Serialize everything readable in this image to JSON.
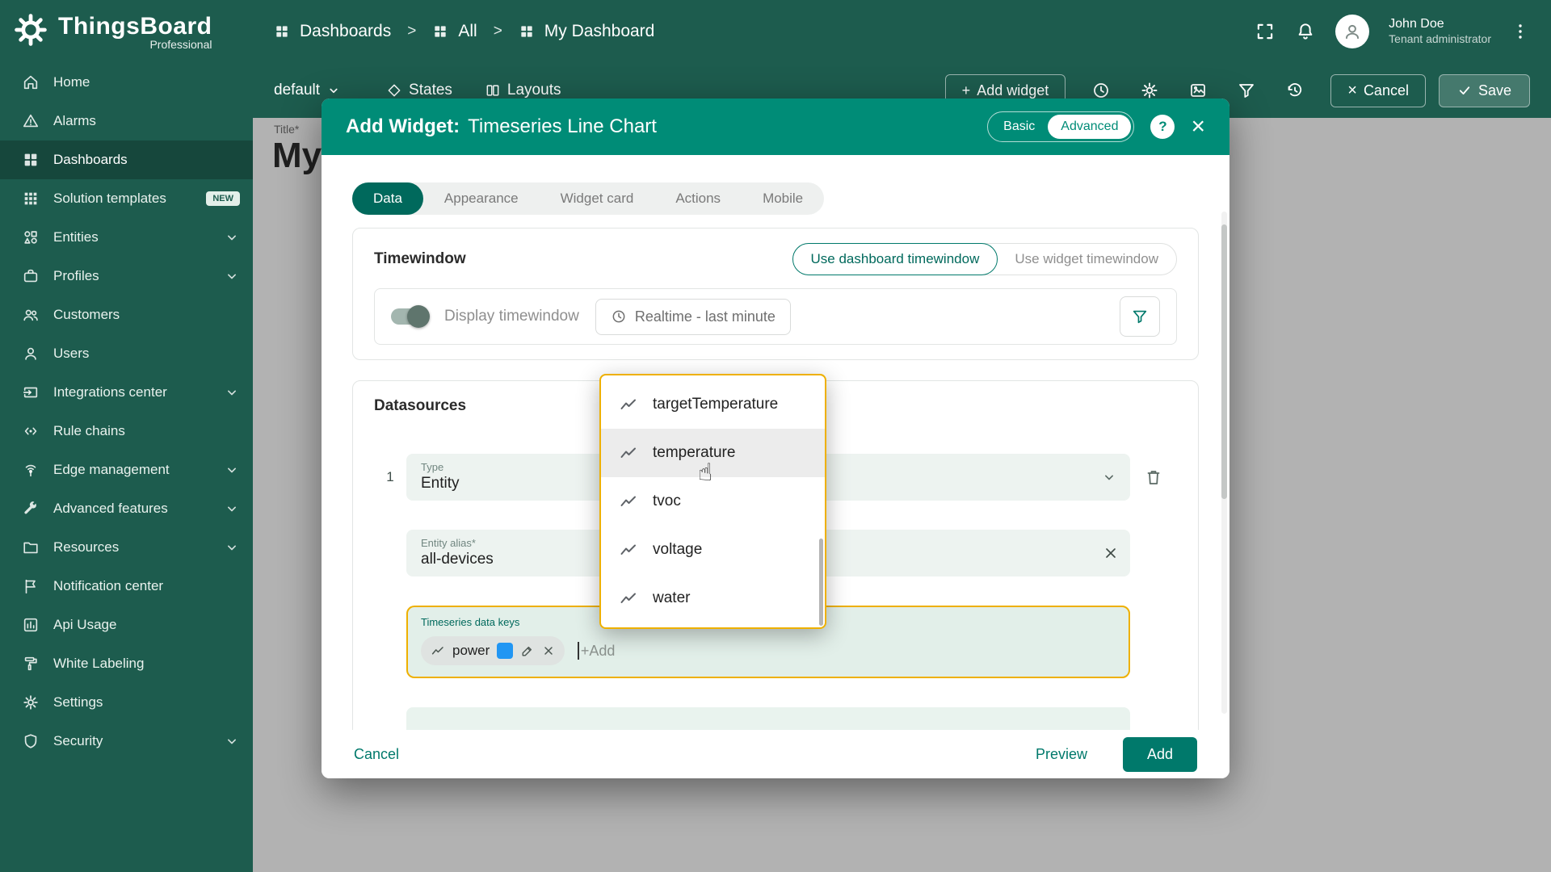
{
  "colors": {
    "sidebar": "#1d5c4e",
    "topbar": "#1d5c4e",
    "primary": "#008c77",
    "primary_dark": "#00796b",
    "tab_active": "#00695c",
    "amber": "#eeb000",
    "chip_blue": "#2196f3",
    "field_bg": "#edf3f0",
    "keys_bg": "#e2efe9",
    "overlay": "rgba(33,33,33,0.35)"
  },
  "icons": {
    "close": "×",
    "help": "?",
    "plus": "+",
    "separator": ">",
    "pointer": "☝"
  },
  "brand": {
    "name": "ThingsBoard",
    "edition": "Professional"
  },
  "sidebar": {
    "items": [
      {
        "label": "Home"
      },
      {
        "label": "Alarms"
      },
      {
        "label": "Dashboards"
      },
      {
        "label": "Solution templates",
        "badge": "NEW"
      },
      {
        "label": "Entities"
      },
      {
        "label": "Profiles"
      },
      {
        "label": "Customers"
      },
      {
        "label": "Users"
      },
      {
        "label": "Integrations center"
      },
      {
        "label": "Rule chains"
      },
      {
        "label": "Edge management"
      },
      {
        "label": "Advanced features"
      },
      {
        "label": "Resources"
      },
      {
        "label": "Notification center"
      },
      {
        "label": "Api Usage"
      },
      {
        "label": "White Labeling"
      },
      {
        "label": "Settings"
      },
      {
        "label": "Security"
      }
    ]
  },
  "header": {
    "breadcrumb": [
      "Dashboards",
      "All",
      "My Dashboard"
    ],
    "user_name": "John Doe",
    "user_role": "Tenant administrator"
  },
  "toolbar": {
    "state": "default",
    "states": "States",
    "layouts": "Layouts",
    "add_widget": "Add widget",
    "cancel": "Cancel",
    "save": "Save"
  },
  "canvas": {
    "title_label": "Title*",
    "title_value": "My"
  },
  "dialog": {
    "title_prefix": "Add Widget:",
    "title": "Timeseries Line Chart",
    "mode_basic": "Basic",
    "mode_advanced": "Advanced",
    "tabs": [
      "Data",
      "Appearance",
      "Widget card",
      "Actions",
      "Mobile"
    ],
    "active_tab": "Data",
    "timewindow": {
      "heading": "Timewindow",
      "use_dashboard": "Use dashboard timewindow",
      "use_widget": "Use widget timewindow",
      "display_label": "Display timewindow",
      "realtime": "Realtime - last minute"
    },
    "datasources": {
      "heading": "Datasources",
      "index": "1",
      "type_label": "Type",
      "type_value": "Entity",
      "alias_label": "Entity alias*",
      "alias_value": "all-devices",
      "keys_label": "Timeseries data keys",
      "key": "power",
      "add_placeholder": "+Add"
    },
    "footer": {
      "cancel": "Cancel",
      "preview": "Preview",
      "add": "Add"
    }
  },
  "dropdown": {
    "options": [
      "targetTemperature",
      "temperature",
      "tvoc",
      "voltage",
      "water"
    ],
    "hovered": "temperature"
  }
}
